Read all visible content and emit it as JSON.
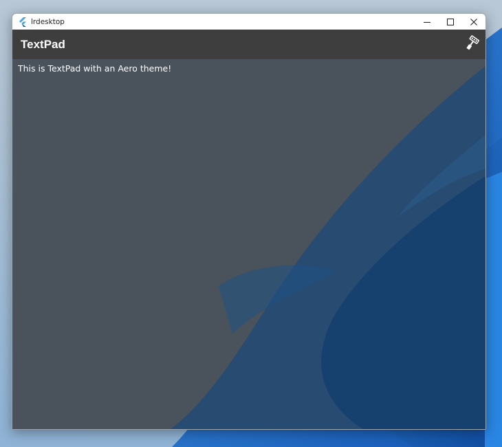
{
  "window": {
    "title": "lrdesktop",
    "icon": "flutter-logo-icon",
    "controls": [
      "minimize-icon",
      "maximize-icon",
      "close-icon"
    ]
  },
  "appbar": {
    "title": "TextPad",
    "action_icon": "paint-roller-icon"
  },
  "editor": {
    "text": "This is TextPad with an Aero theme!"
  },
  "colors": {
    "titlebar": "#ffffff",
    "appbar": "#3e3e3e",
    "content": "#4a525b",
    "accent_wallpaper": "#1f5fa6"
  }
}
